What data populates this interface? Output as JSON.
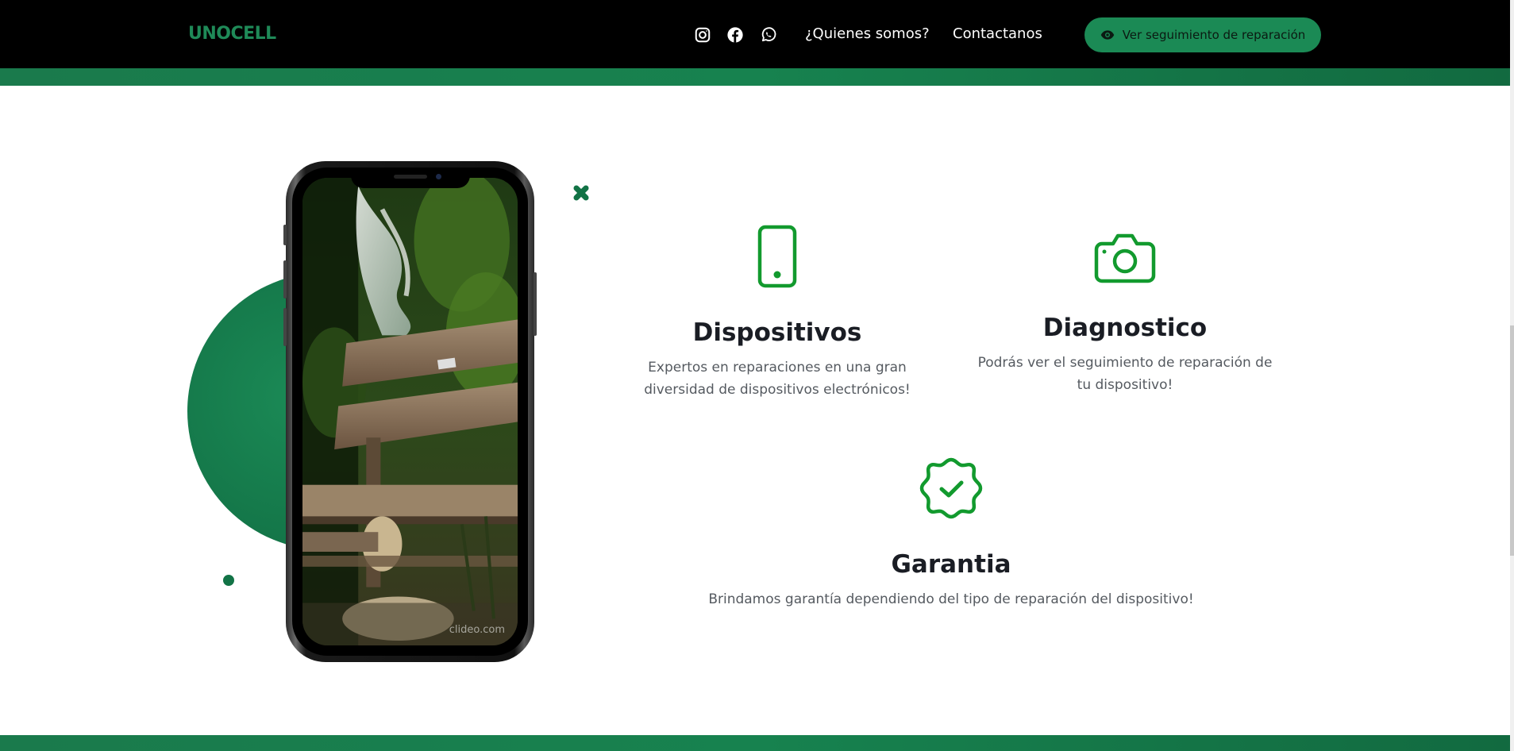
{
  "navbar": {
    "brand": "UNOCELL",
    "social_icons": [
      "instagram-icon",
      "facebook-icon",
      "whatsapp-icon"
    ],
    "links": [
      "¿Quienes somos?",
      "Contactanos"
    ],
    "track_button": {
      "icon": "eye-icon",
      "label": "Ver seguimiento de reparación"
    }
  },
  "hero": {
    "phone_watermark": "clideo.com"
  },
  "features": [
    {
      "icon": "phone-icon",
      "title": "Dispositivos",
      "desc_lines": [
        "Expertos en reparaciones en una gran",
        "diversidad de dispositivos electrónicos!"
      ]
    },
    {
      "icon": "camera-icon",
      "title": "Diagnostico",
      "desc_lines": [
        "Podrás ver el seguimiento de reparación de",
        "tu dispositivo!"
      ]
    },
    {
      "icon": "badge-check-icon",
      "title": "Garantia",
      "desc_lines": [
        "Brindamos garantía dependiendo del tipo de reparación del dispositivo!"
      ]
    }
  ],
  "colors": {
    "brand_green": "#1f8a58",
    "button_green": "#1b8a55",
    "icon_green": "#129a2e",
    "band_green": "#17824f",
    "navbar_bg": "#000000"
  }
}
